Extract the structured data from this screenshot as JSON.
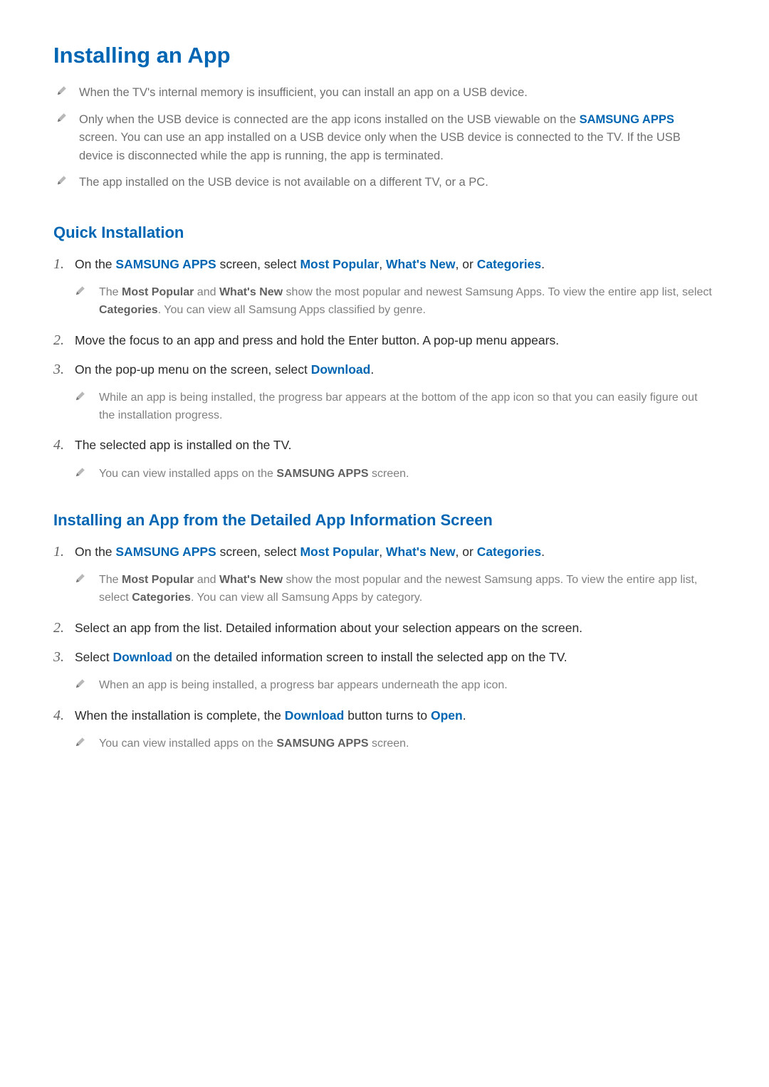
{
  "title": "Installing an App",
  "notes": [
    {
      "parts": [
        {
          "t": "When the TV's internal memory is insufficient, you can install an app on a USB device."
        }
      ]
    },
    {
      "parts": [
        {
          "t": "Only when the USB device is connected are the app icons installed on the USB viewable on the "
        },
        {
          "t": "SAMSUNG APPS",
          "hl": true
        },
        {
          "t": " screen. You can use an app installed on a USB device only when the USB device is connected to the TV. If the USB device is disconnected while the app is running, the app is terminated."
        }
      ]
    },
    {
      "parts": [
        {
          "t": "The app installed on the USB device is not available on a different TV, or a PC."
        }
      ]
    }
  ],
  "sections": [
    {
      "title": "Quick Installation",
      "steps": [
        {
          "num": "1.",
          "body": [
            {
              "t": "On the "
            },
            {
              "t": "SAMSUNG APPS",
              "hl": true
            },
            {
              "t": " screen, select "
            },
            {
              "t": "Most Popular",
              "hl": true
            },
            {
              "t": ", "
            },
            {
              "t": "What's New",
              "hl": true
            },
            {
              "t": ", or "
            },
            {
              "t": "Categories",
              "hl": true
            },
            {
              "t": "."
            }
          ],
          "note": [
            {
              "t": "The "
            },
            {
              "t": "Most Popular",
              "hlg": true
            },
            {
              "t": " and "
            },
            {
              "t": "What's New",
              "hlg": true
            },
            {
              "t": " show the most popular and newest Samsung Apps. To view the entire app list, select "
            },
            {
              "t": "Categories",
              "hlg": true
            },
            {
              "t": ". You can view all Samsung Apps classified by genre."
            }
          ]
        },
        {
          "num": "2.",
          "body": [
            {
              "t": "Move the focus to an app and press and hold the Enter button. A pop-up menu appears."
            }
          ]
        },
        {
          "num": "3.",
          "body": [
            {
              "t": "On the pop-up menu on the screen, select "
            },
            {
              "t": "Download",
              "hl": true
            },
            {
              "t": "."
            }
          ],
          "note": [
            {
              "t": "While an app is being installed, the progress bar appears at the bottom of the app icon so that you can easily figure out the installation progress."
            }
          ]
        },
        {
          "num": "4.",
          "body": [
            {
              "t": "The selected app is installed on the TV."
            }
          ],
          "note": [
            {
              "t": "You can view installed apps on the "
            },
            {
              "t": "SAMSUNG APPS",
              "hlg": true
            },
            {
              "t": " screen."
            }
          ]
        }
      ]
    },
    {
      "title": "Installing an App from the Detailed App Information Screen",
      "steps": [
        {
          "num": "1.",
          "body": [
            {
              "t": "On the "
            },
            {
              "t": "SAMSUNG APPS",
              "hl": true
            },
            {
              "t": " screen, select "
            },
            {
              "t": "Most Popular",
              "hl": true
            },
            {
              "t": ", "
            },
            {
              "t": "What's New",
              "hl": true
            },
            {
              "t": ", or "
            },
            {
              "t": "Categories",
              "hl": true
            },
            {
              "t": "."
            }
          ],
          "note": [
            {
              "t": "The "
            },
            {
              "t": "Most Popular",
              "hlg": true
            },
            {
              "t": " and "
            },
            {
              "t": "What's New",
              "hlg": true
            },
            {
              "t": " show the most popular and the newest Samsung apps. To view the entire app list, select "
            },
            {
              "t": "Categories",
              "hlg": true
            },
            {
              "t": ". You can view all Samsung Apps by category."
            }
          ]
        },
        {
          "num": "2.",
          "body": [
            {
              "t": "Select an app from the list. Detailed information about your selection appears on the screen."
            }
          ]
        },
        {
          "num": "3.",
          "body": [
            {
              "t": "Select "
            },
            {
              "t": "Download",
              "hl": true
            },
            {
              "t": " on the detailed information screen to install the selected app on the TV."
            }
          ],
          "note": [
            {
              "t": "When an app is being installed, a progress bar appears underneath the app icon."
            }
          ]
        },
        {
          "num": "4.",
          "body": [
            {
              "t": "When the installation is complete, the "
            },
            {
              "t": "Download",
              "hl": true
            },
            {
              "t": " button turns to "
            },
            {
              "t": "Open",
              "hl": true
            },
            {
              "t": "."
            }
          ],
          "note": [
            {
              "t": "You can view installed apps on the "
            },
            {
              "t": "SAMSUNG APPS",
              "hlg": true
            },
            {
              "t": " screen."
            }
          ]
        }
      ]
    }
  ]
}
